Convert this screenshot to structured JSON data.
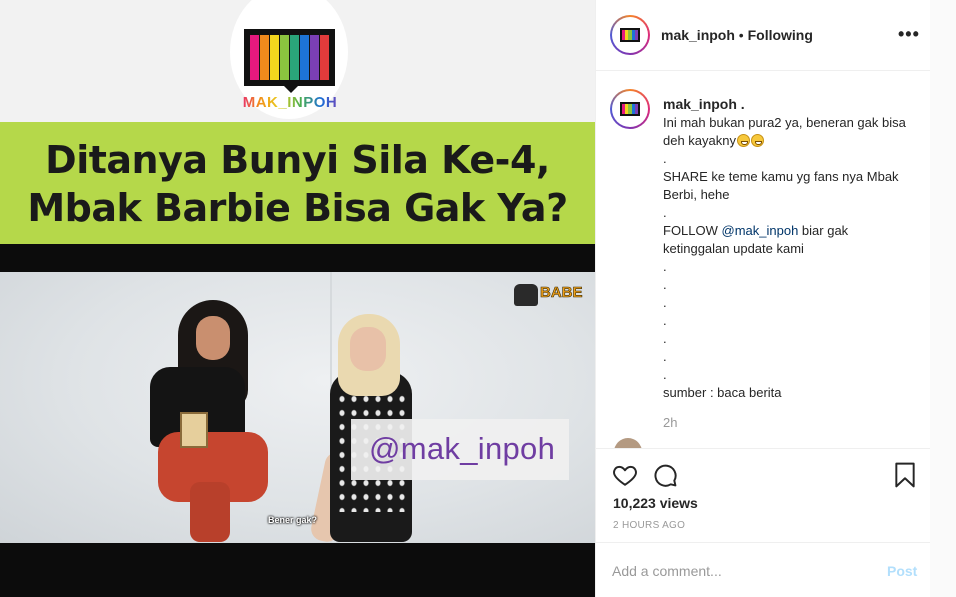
{
  "media": {
    "brand": "MAK_INPOH",
    "logo_colors": [
      "#e6197e",
      "#f08a1c",
      "#f3d61e",
      "#8bc43f",
      "#2aa57a",
      "#1d74d6",
      "#7b3fb5",
      "#e23b3b"
    ],
    "headline_line1": "Ditanya Bunyi Sila Ke-4,",
    "headline_line2": "Mbak Barbie Bisa Gak Ya?",
    "headline_bg": "#b5d84a",
    "watermark": "@mak_inpoh",
    "channel_badge": "BABE",
    "subtitle": "Bener gak?"
  },
  "header": {
    "username": "mak_inpoh",
    "separator": "•",
    "follow_status": "Following",
    "more_icon": "more-horizontal-icon"
  },
  "caption": {
    "username": "mak_inpoh .",
    "line1": "Ini mah bukan pura2 ya, beneran gak bisa deh kayakny",
    "dot1": ".",
    "line2": "SHARE ke teme kamu yg fans nya Mbak Berbi, hehe",
    "dot2": ".",
    "follow_prefix": "FOLLOW ",
    "follow_mention": "@mak_inpoh",
    "follow_suffix": " biar gak ketinggalan update kami",
    "dots": [
      ".",
      ".",
      ".",
      ".",
      ".",
      ".",
      "."
    ],
    "source": "sumber : baca berita",
    "time": "2h"
  },
  "actions": {
    "like_icon": "heart-icon",
    "comment_icon": "comment-icon",
    "save_icon": "bookmark-icon",
    "views": "10,223 views",
    "time_ago": "2 HOURS AGO"
  },
  "comment_box": {
    "placeholder": "Add a comment...",
    "post_label": "Post",
    "post_color": "#b2dffc"
  }
}
